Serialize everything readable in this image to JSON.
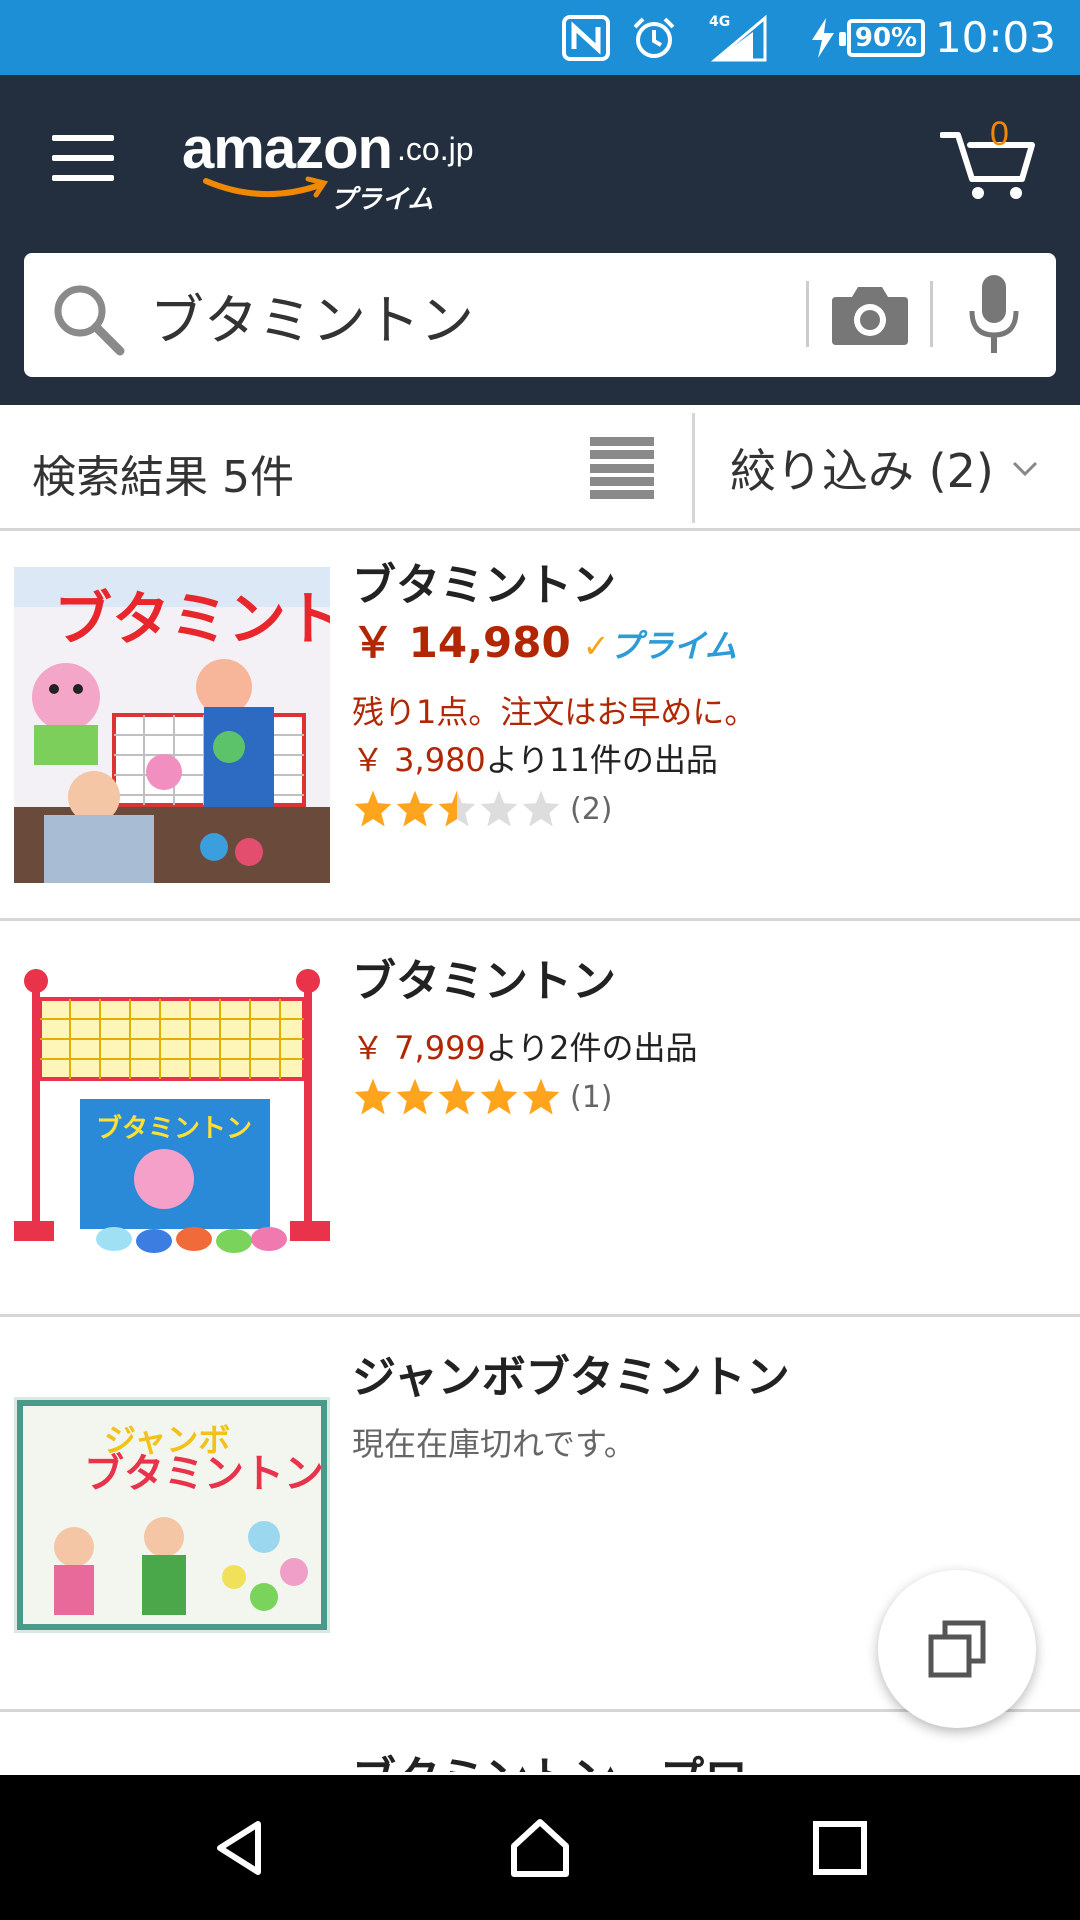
{
  "status_bar": {
    "time": "10:03",
    "battery": "90%",
    "network": "4G",
    "icons": [
      "nfc-icon",
      "alarm-icon",
      "signal-icon",
      "charging-icon",
      "battery-icon"
    ]
  },
  "header": {
    "logo_main": "amazon",
    "logo_domain": ".co.jp",
    "logo_sub": "プライム",
    "cart_count": "0"
  },
  "search": {
    "query": "ブタミントン"
  },
  "filter_bar": {
    "result_count": "検索結果 5件",
    "refine_label": "絞り込み (2)"
  },
  "products": [
    {
      "title": "ブタミントン",
      "price": "￥ 14,980",
      "prime_label": "プライム",
      "stock_note": "残り1点。注文はお早めに。",
      "offer_price": "￥ 3,980",
      "offer_text": "より11件の出品",
      "rating": 2.5,
      "rating_count": "(2)"
    },
    {
      "title": "ブタミントン",
      "offer_price": "￥ 7,999",
      "offer_text": "より2件の出品",
      "rating": 5,
      "rating_count": "(1)"
    },
    {
      "title": "ジャンボブタミントン",
      "availability": "現在在庫切れです。"
    },
    {
      "title": "ブタミントン　プロ"
    }
  ],
  "colors": {
    "status_bar": "#1c8fd6",
    "header": "#232f3e",
    "price_red": "#b12704",
    "star_gold": "#ffa41c",
    "prime_blue": "#2d9bd6",
    "cart_orange": "#f08804"
  }
}
